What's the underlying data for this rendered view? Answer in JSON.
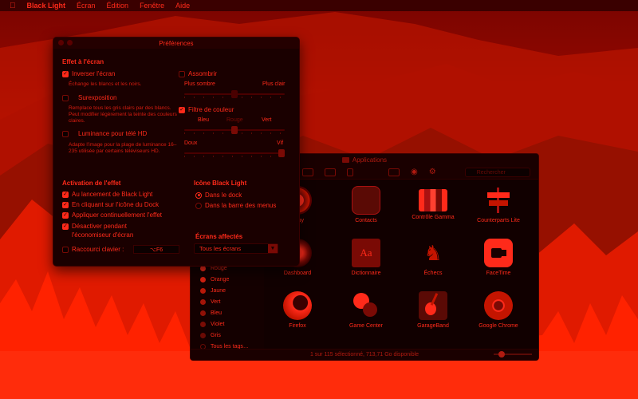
{
  "menubar": {
    "apple_icon": "apple-icon",
    "app_name": "Black Light",
    "items": [
      "Écran",
      "Édition",
      "Fenêtre",
      "Aide"
    ]
  },
  "prefs": {
    "title": "Préférences",
    "effet": {
      "title": "Effet à l'écran",
      "inverser": {
        "label": "Inverser l'écran",
        "checked": true,
        "desc": "Échange les blancs et les noirs."
      },
      "surexposition": {
        "label": "Surexposition",
        "checked": false,
        "desc": "Remplace tous les gris clairs par des blancs. Peut modifier légèrement la teinte des couleurs claires."
      },
      "luminance": {
        "label": "Luminance pour télé HD",
        "checked": false,
        "desc": "Adapte l'image pour la plage de luminance 16–235 utilisée par certains téléviseurs HD."
      }
    },
    "assombrir": {
      "label": "Assombrir",
      "checked": false,
      "min_label": "Plus sombre",
      "max_label": "Plus clair",
      "level": 0.5
    },
    "filtre": {
      "label": "Filtre de couleur",
      "checked": true,
      "left_label": "Bleu",
      "mid_label": "Rouge",
      "right_label": "Vert",
      "hue_level": 0.5,
      "soft_label": "Doux",
      "vivid_label": "Vif",
      "intensity_level": 1.0
    },
    "activation": {
      "title": "Activation de l'effet",
      "items": [
        {
          "label": "Au lancement de Black Light",
          "checked": true
        },
        {
          "label": "En cliquant sur l'icône du Dock",
          "checked": true
        },
        {
          "label": "Appliquer continuellement l'effet",
          "checked": true
        },
        {
          "label": "Désactiver pendant",
          "checked": true
        },
        {
          "label": "l'économiseur d'écran",
          "checked": null
        }
      ],
      "shortcut": {
        "label": "Raccourci clavier :",
        "checked": false,
        "value": "⌥F6"
      }
    },
    "icone": {
      "title": "Icône Black Light",
      "options": [
        {
          "label": "Dans le dock",
          "selected": true
        },
        {
          "label": "Dans la barre des menus",
          "selected": false
        }
      ]
    },
    "ecrans": {
      "title": "Écrans affectés",
      "selected": "Tous les écrans"
    }
  },
  "finder": {
    "title": "Applications",
    "search_placeholder": "Rechercher",
    "tags": [
      {
        "label": "Rouge",
        "color": "#ff2a1a"
      },
      {
        "label": "Orange",
        "color": "#d42010"
      },
      {
        "label": "Jaune",
        "color": "#b81808"
      },
      {
        "label": "Vert",
        "color": "#a41408"
      },
      {
        "label": "Bleu",
        "color": "#901006"
      },
      {
        "label": "Violet",
        "color": "#7a0c05"
      },
      {
        "label": "Gris",
        "color": "#6a0a04"
      },
      {
        "label": "Tous les tags…",
        "color": null
      }
    ],
    "apps": [
      {
        "label": "Aquy",
        "icon": "chrome-like-icon"
      },
      {
        "label": "Contacts",
        "icon": "contacts-icon"
      },
      {
        "label": "Contrôle Gamma",
        "icon": "display-icon"
      },
      {
        "label": "Counterparts Lite",
        "icon": "signpost-icon"
      },
      {
        "label": "Dashboard",
        "icon": "dashboard-icon"
      },
      {
        "label": "Dictionnaire",
        "icon": "dictionary-icon"
      },
      {
        "label": "Échecs",
        "icon": "chess-icon"
      },
      {
        "label": "FaceTime",
        "icon": "facetime-icon"
      },
      {
        "label": "Firefox",
        "icon": "firefox-icon"
      },
      {
        "label": "Game Center",
        "icon": "game-center-icon"
      },
      {
        "label": "GarageBand",
        "icon": "guitar-icon"
      },
      {
        "label": "Google Chrome",
        "icon": "chrome-icon"
      }
    ],
    "status": "1 sur 115 sélectionné, 713,71 Go disponible",
    "zoom_level": 0.15
  }
}
